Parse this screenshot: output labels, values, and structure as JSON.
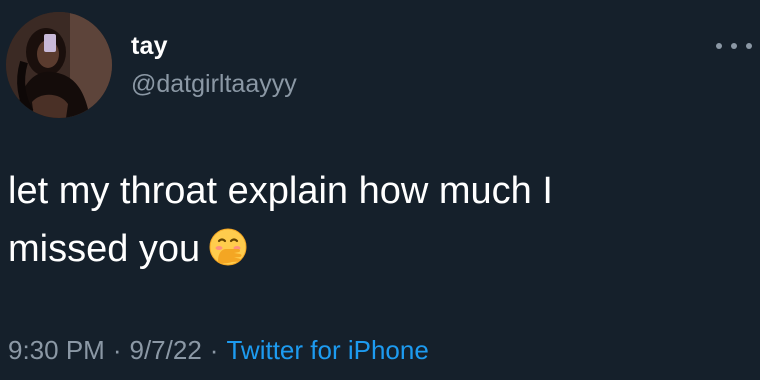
{
  "tweet": {
    "author_name": "tay",
    "author_handle": "@datgirltaayyy",
    "text_line1": "let my throat explain how much I",
    "text_line2": "missed you",
    "emoji": "face-with-hand-over-mouth",
    "time": "9:30 PM",
    "separator": "·",
    "date": "9/7/22",
    "source": "Twitter for iPhone"
  },
  "colors": {
    "background": "#15202b",
    "primary_text": "#ffffff",
    "secondary_text": "#8b98a5",
    "accent": "#1d9bf0"
  }
}
